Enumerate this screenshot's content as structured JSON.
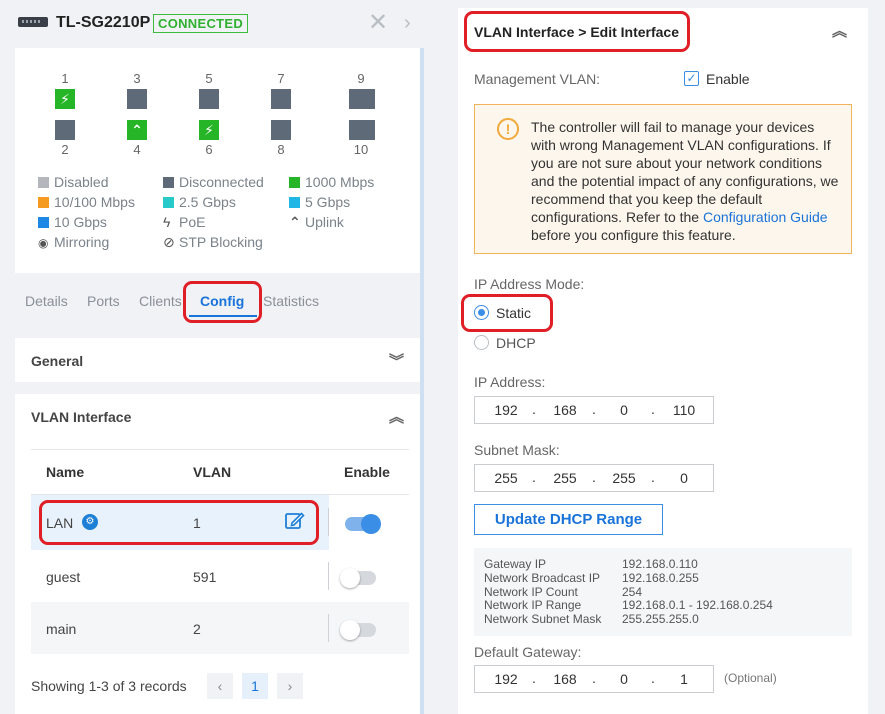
{
  "device": {
    "name": "TL-SG2210P",
    "status": "CONNECTED"
  },
  "ports": {
    "top": [
      {
        "num": "1",
        "state": "1000 Mbps",
        "glyph": "⚡"
      },
      {
        "num": "3",
        "state": "Disconnected",
        "glyph": ""
      },
      {
        "num": "5",
        "state": "Disconnected",
        "glyph": ""
      },
      {
        "num": "7",
        "state": "Disconnected",
        "glyph": ""
      },
      {
        "num": "9",
        "state": "Disconnected",
        "glyph": ""
      }
    ],
    "bottom": [
      {
        "num": "2",
        "state": "Disconnected",
        "glyph": ""
      },
      {
        "num": "4",
        "state": "1000 Mbps",
        "glyph": "⌃"
      },
      {
        "num": "6",
        "state": "1000 Mbps",
        "glyph": "⚡"
      },
      {
        "num": "8",
        "state": "Disconnected",
        "glyph": ""
      },
      {
        "num": "10",
        "state": "Disconnected",
        "glyph": ""
      }
    ]
  },
  "legend": [
    {
      "label": "Disabled",
      "color": "#b3b7bc"
    },
    {
      "label": "Disconnected",
      "color": "#5f6a78"
    },
    {
      "label": "1000 Mbps",
      "color": "#26b526"
    },
    {
      "label": "10/100 Mbps",
      "color": "#f59b22"
    },
    {
      "label": "2.5 Gbps",
      "color": "#27c9c9"
    },
    {
      "label": "5 Gbps",
      "color": "#20b7e6"
    },
    {
      "label": "10 Gbps",
      "color": "#1e88e5"
    },
    {
      "label": "PoE",
      "icon": "bolt-icon"
    },
    {
      "label": "Uplink",
      "icon": "chevron-up-icon"
    },
    {
      "label": "Mirroring",
      "icon": "eye-icon"
    },
    {
      "label": "STP Blocking",
      "icon": "blocked-icon"
    }
  ],
  "tabs": [
    "Details",
    "Ports",
    "Clients",
    "Config",
    "Statistics"
  ],
  "active_tab": "Config",
  "sections": {
    "general": "General",
    "vlan_interface": "VLAN Interface"
  },
  "vlan_table": {
    "columns": [
      "Name",
      "VLAN",
      "Enable"
    ],
    "rows": [
      {
        "name": "LAN",
        "vlan": "1",
        "enabled": true
      },
      {
        "name": "guest",
        "vlan": "591",
        "enabled": false
      },
      {
        "name": "main",
        "vlan": "2",
        "enabled": false
      }
    ],
    "showing": "Showing 1-3 of 3 records",
    "page": "1"
  },
  "edit": {
    "breadcrumb": "VLAN Interface > Edit Interface",
    "mgmt_label": "Management VLAN:",
    "mgmt_enable": "Enable",
    "warning_lines": [
      "The controller will fail to manage your devices",
      "with wrong Management VLAN configurations. If",
      "you are not sure about your network conditions",
      "and the potential impact of any configurations, we",
      "recommend that you keep the default"
    ],
    "warning_pre_link": "configurations. Refer to the ",
    "warning_link": "Configuration Guide",
    "warning_post": "before you configure this feature.",
    "ip_mode_label": "IP Address Mode:",
    "mode_static": "Static",
    "mode_dhcp": "DHCP",
    "ip_label": "IP Address:",
    "ip": [
      "192",
      "168",
      "0",
      "110"
    ],
    "mask_label": "Subnet Mask:",
    "mask": [
      "255",
      "255",
      "255",
      "0"
    ],
    "update_btn": "Update DHCP Range",
    "info": [
      {
        "k": "Gateway IP",
        "v": "192.168.0.110"
      },
      {
        "k": "Network Broadcast IP",
        "v": "192.168.0.255"
      },
      {
        "k": "Network IP Count",
        "v": "254"
      },
      {
        "k": "Network IP Range",
        "v": "192.168.0.1 - 192.168.0.254"
      },
      {
        "k": "Network Subnet Mask",
        "v": "255.255.255.0"
      }
    ],
    "gateway_label": "Default Gateway:",
    "gateway": [
      "192",
      "168",
      "0",
      "1"
    ],
    "optional": "(Optional)"
  }
}
